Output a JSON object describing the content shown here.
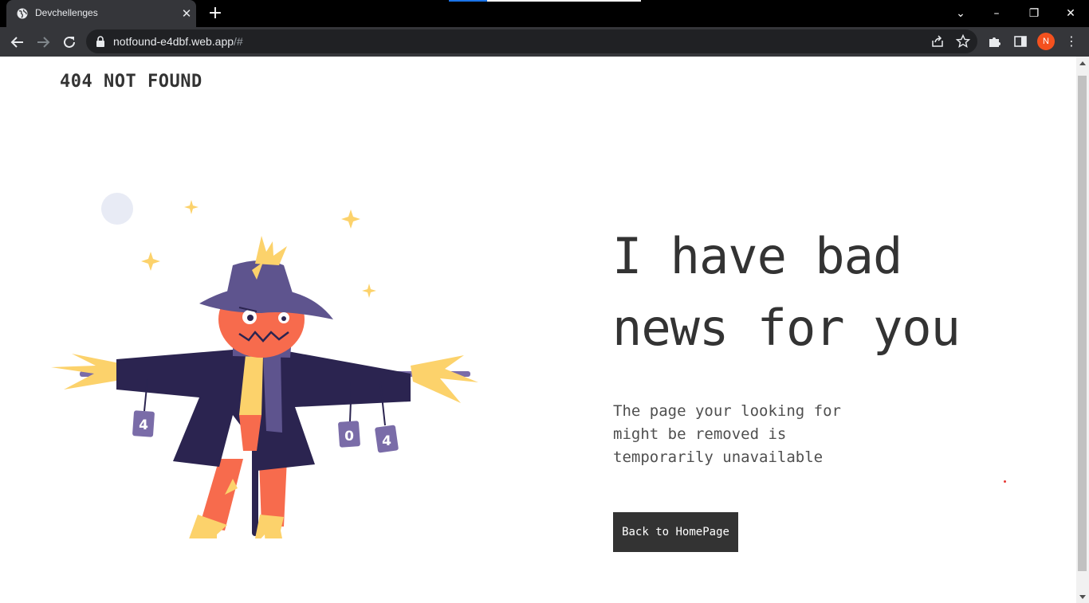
{
  "browser": {
    "tab_title": "Devchellenges",
    "url_host": "notfound-e4dbf.web.app",
    "url_path": "/#",
    "profile_initial": "N",
    "icons": [
      "globe-icon",
      "close-icon",
      "plus-icon",
      "back-arrow-icon",
      "forward-arrow-icon",
      "reload-icon",
      "lock-icon",
      "share-icon",
      "star-icon",
      "puzzle-icon",
      "side-panel-icon",
      "more-icon",
      "minimize-icon",
      "restore-icon",
      "window-close-icon",
      "chevron-down-icon"
    ]
  },
  "page": {
    "site_title": "404 NOT FOUND",
    "headline_line1": "I have bad",
    "headline_line2": "news for you",
    "subtext_line1": "The page your looking for",
    "subtext_line2": "might be removed is",
    "subtext_line3": "temporarily unavailable",
    "button_label": "Back to HomePage",
    "illustration": {
      "subject": "scarecrow",
      "cans": [
        "4",
        "0",
        "4"
      ]
    }
  },
  "colors": {
    "text_dark": "#333333",
    "button_bg": "#333333",
    "scarecrow_coat": "#2b2450",
    "scarecrow_hat": "#5e548e",
    "scarecrow_face": "#f76b4d",
    "straw": "#fcd26b",
    "moon": "#e8ebf5"
  }
}
